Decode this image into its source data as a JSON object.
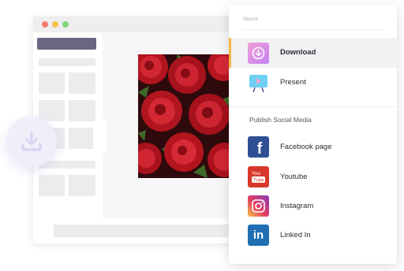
{
  "menu": {
    "search_placeholder": "Search",
    "items": [
      {
        "label": "Download",
        "icon": "download-icon",
        "active": true,
        "color": "#d97ae8"
      },
      {
        "label": "Present",
        "icon": "present-icon",
        "active": false,
        "color": "#5cc8f0"
      }
    ],
    "social_heading": "Publish Social Media",
    "social": [
      {
        "label": "Facebook page",
        "icon": "facebook-icon",
        "color": "#2f4f95"
      },
      {
        "label": "Youtube",
        "icon": "youtube-icon",
        "color": "#d8382b"
      },
      {
        "label": "Instagram",
        "icon": "instagram-icon",
        "color": "#c2378f"
      },
      {
        "label": "Linked In",
        "icon": "linkedin-icon",
        "color": "#1f6fb2"
      }
    ]
  },
  "colors": {
    "accent": "#f5b642",
    "fab_icon": "#d7d3f3"
  }
}
